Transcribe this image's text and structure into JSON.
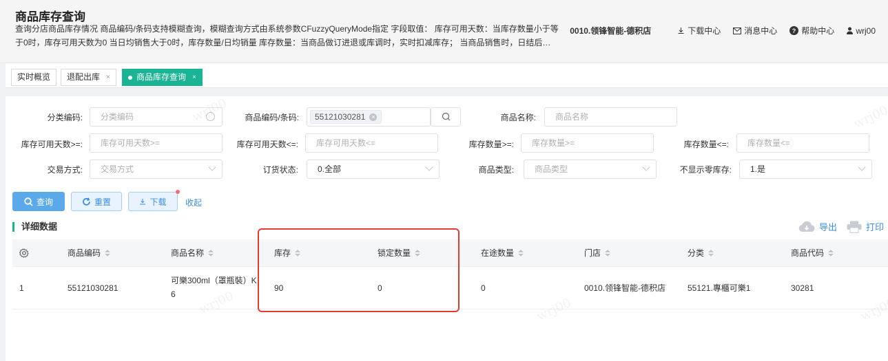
{
  "header": {
    "title": "商品库存查询",
    "description": "查询分店商品库存情况 商品编码/条码支持模糊查询，模糊查询方式由系统参数CFuzzyQueryMode指定 字段取值： 库存可用天数：当库存数量小于等于0时，库存可用天数为0 当日均销售大于0时，库存数量/日均销量 库存数量：当商品做订进退或库调时，实时扣减库存； 当商品销售时，日结后…",
    "store": "0010.领锋智能-德积店",
    "download_center": "下载中心",
    "message_center": "消息中心",
    "help_center": "帮助中心",
    "user": "wrj00"
  },
  "tabs": [
    {
      "label": "实时概览"
    },
    {
      "label": "退配出库",
      "close": "×"
    },
    {
      "label": "商品库存查询",
      "close": "×"
    }
  ],
  "filters": {
    "category_code": {
      "label": "分类编码:",
      "placeholder": "分类编码"
    },
    "item_code": {
      "label": "商品编码/条码:",
      "tag": "55121030281"
    },
    "item_name": {
      "label": "商品名称:",
      "placeholder": "商品名称"
    },
    "days_gte": {
      "label": "库存可用天数>=:",
      "placeholder": "库存可用天数>="
    },
    "days_lte": {
      "label": "库存可用天数<=:",
      "placeholder": "库存可用天数<="
    },
    "qty_gte": {
      "label": "库存数量>=:",
      "placeholder": "库存数量>="
    },
    "qty_lte": {
      "label": "库存数量<=:",
      "placeholder": "库存数量<="
    },
    "trade_mode": {
      "label": "交易方式:",
      "placeholder": "交易方式"
    },
    "order_status": {
      "label": "订货状态:",
      "value": "0.全部"
    },
    "item_type": {
      "label": "商品类型:",
      "placeholder": "商品类型"
    },
    "hide_zero": {
      "label": "不显示零库存:",
      "value": "1.是"
    }
  },
  "buttons": {
    "query": "查询",
    "reset": "重置",
    "download": "下载",
    "collapse": "收起"
  },
  "section": {
    "title": "详细数据",
    "export": "导出",
    "print": "打印"
  },
  "table": {
    "columns": [
      "商品编码",
      "商品名称",
      "库存",
      "锁定数量",
      "在途数量",
      "门店",
      "分类",
      "商品代码"
    ],
    "rows": [
      {
        "index": "1",
        "code": "55121030281",
        "name": "可樂300ml（罩瓶裝）K",
        "name2": "6",
        "stock": "90",
        "locked": "0",
        "in_transit": "0",
        "store": "0010.领锋智能-德积店",
        "category": "55121.專櫃可樂1",
        "item_code": "30281"
      }
    ]
  },
  "watermark": "wrj00",
  "colors": {
    "accent_green": "#1ab394",
    "primary_blue": "#3a8ee6",
    "highlight_red": "#e53935"
  }
}
